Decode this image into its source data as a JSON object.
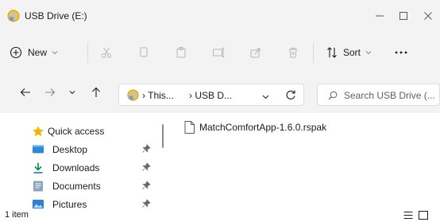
{
  "window": {
    "title": "USB Drive (E:)"
  },
  "toolbar": {
    "new_label": "New",
    "sort_label": "Sort"
  },
  "address": {
    "crumb1": "This...",
    "crumb2": "USB D..."
  },
  "search": {
    "placeholder": "Search USB Drive (..."
  },
  "sidebar": {
    "items": [
      {
        "label": "Quick access",
        "icon": "star-icon",
        "pinned": false
      },
      {
        "label": "Desktop",
        "icon": "desktop-folder-icon",
        "pinned": true
      },
      {
        "label": "Downloads",
        "icon": "download-arrow-icon",
        "pinned": true
      },
      {
        "label": "Documents",
        "icon": "documents-folder-icon",
        "pinned": true
      },
      {
        "label": "Pictures",
        "icon": "pictures-folder-icon",
        "pinned": true
      }
    ]
  },
  "files": [
    {
      "name": "MatchComfortApp-1.6.0.rspak",
      "icon": "file-icon"
    }
  ],
  "status": {
    "count_text": "1 item"
  },
  "colors": {
    "chrome_bg": "#f3f3f3",
    "accent": "#0067c0",
    "star": "#f4b400"
  }
}
